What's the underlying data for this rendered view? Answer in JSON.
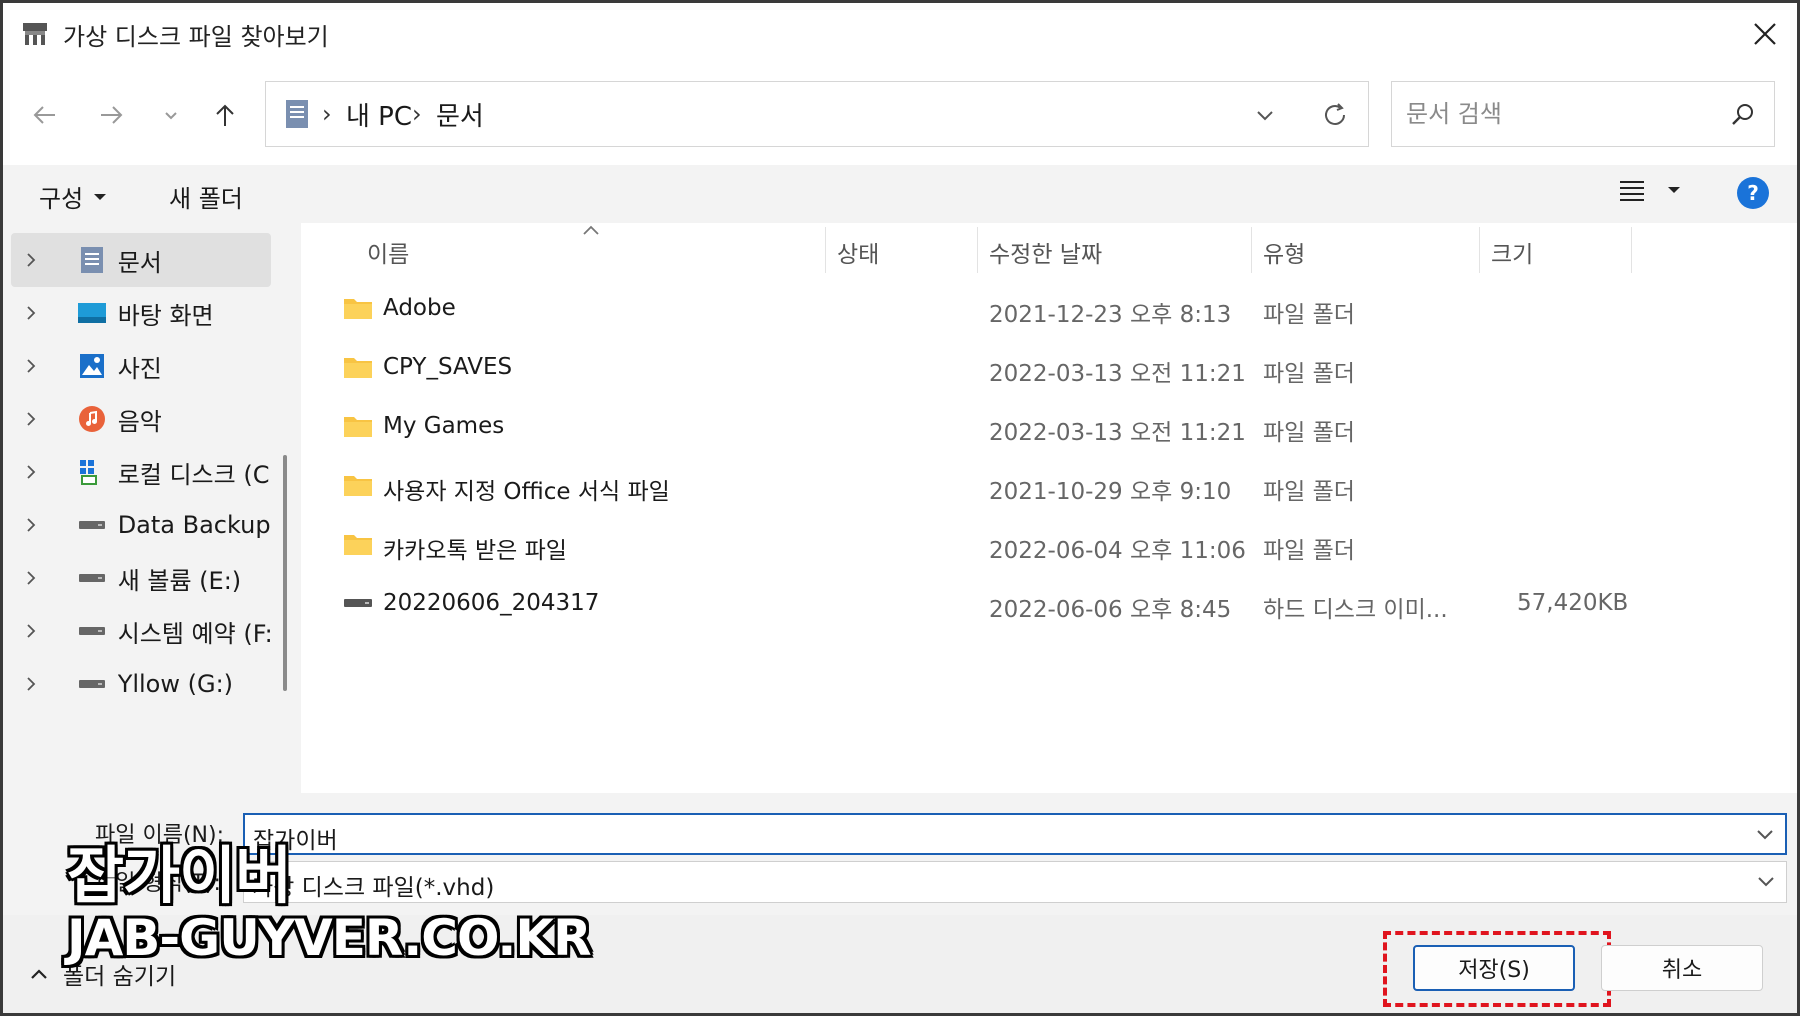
{
  "window": {
    "title": "가상 디스크 파일 찾아보기"
  },
  "address": {
    "segments": [
      "내 PC",
      "문서"
    ]
  },
  "search": {
    "placeholder": "문서 검색"
  },
  "toolbar": {
    "organize_label": "구성",
    "new_folder_label": "새 폴더"
  },
  "sidebar": {
    "items": [
      {
        "label": "문서",
        "icon": "documents-icon",
        "selected": true
      },
      {
        "label": "바탕 화면",
        "icon": "desktop-icon"
      },
      {
        "label": "사진",
        "icon": "pictures-icon"
      },
      {
        "label": "음악",
        "icon": "music-icon"
      },
      {
        "label": "로컬 디스크 (C",
        "icon": "local-disk-icon"
      },
      {
        "label": "Data Backup (D",
        "icon": "drive-icon"
      },
      {
        "label": "새 볼륨 (E:)",
        "icon": "drive-icon"
      },
      {
        "label": "시스템 예약 (F:",
        "icon": "drive-icon"
      },
      {
        "label": "Yllow (G:)",
        "icon": "drive-icon"
      }
    ]
  },
  "columns": {
    "name": "이름",
    "status": "상태",
    "modified": "수정한 날짜",
    "type": "유형",
    "size": "크기"
  },
  "files": [
    {
      "name": "Adobe",
      "modified": "2021-12-23 오후 8:13",
      "type": "파일 폴더",
      "size": "",
      "icon": "folder-icon"
    },
    {
      "name": "CPY_SAVES",
      "modified": "2022-03-13 오전 11:21",
      "type": "파일 폴더",
      "size": "",
      "icon": "folder-icon"
    },
    {
      "name": "My Games",
      "modified": "2022-03-13 오전 11:21",
      "type": "파일 폴더",
      "size": "",
      "icon": "folder-icon"
    },
    {
      "name": "사용자 지정 Office 서식 파일",
      "modified": "2021-10-29 오후 9:10",
      "type": "파일 폴더",
      "size": "",
      "icon": "folder-icon"
    },
    {
      "name": "카카오톡 받은 파일",
      "modified": "2022-06-04 오후 11:06",
      "type": "파일 폴더",
      "size": "",
      "icon": "folder-icon"
    },
    {
      "name": "20220606_204317",
      "modified": "2022-06-06 오후 8:45",
      "type": "하드 디스크 이미...",
      "size": "57,420KB",
      "icon": "vhd-file-icon"
    }
  ],
  "form": {
    "filename_label": "파일 이름(N):",
    "filename_value": "잡가이버",
    "filetype_label": "파일 형식(T):",
    "filetype_value": "가상 디스크 파일(*.vhd)"
  },
  "footer": {
    "hide_folders_label": "폴더 숨기기",
    "save_label": "저장(S)",
    "cancel_label": "취소"
  },
  "watermark": {
    "line1": "잡가이버",
    "line2": "JAB-GUYVER.CO.KR"
  },
  "colors": {
    "accent": "#1a5fb4",
    "highlight": "#e0141e",
    "folder": "#f8c443"
  }
}
